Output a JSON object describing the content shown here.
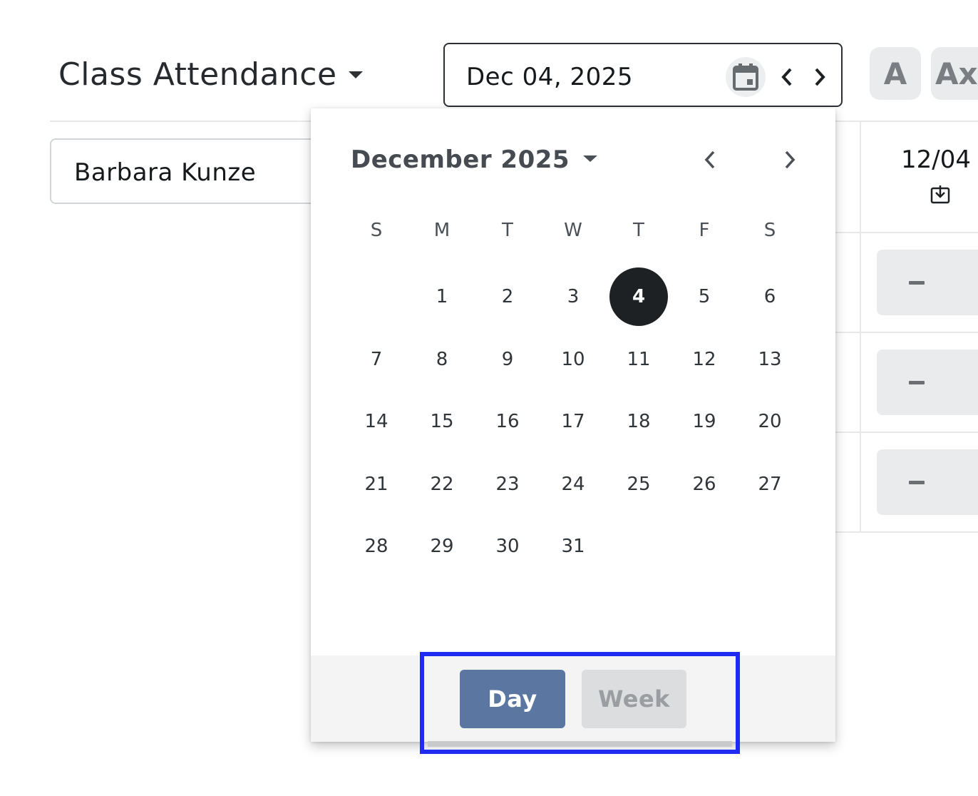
{
  "header": {
    "title": "Class Attendance",
    "date_value": "Dec 04, 2025",
    "icons": [
      "calendar-icon",
      "chevron-left-icon",
      "chevron-right-icon",
      "chevron-down-icon"
    ],
    "pill_a": "A",
    "pill_ax": "Ax"
  },
  "table": {
    "student_name": "Barbara Kunze",
    "column_date": "12/04",
    "rows": [
      {
        "status": "-"
      },
      {
        "status": "-"
      },
      {
        "status": "-"
      }
    ]
  },
  "calendar": {
    "month_label": "December 2025",
    "weekdays": [
      "S",
      "M",
      "T",
      "W",
      "T",
      "F",
      "S"
    ],
    "first_weekday_index": 1,
    "days_in_month": 31,
    "selected_day": 4,
    "footer": {
      "day_label": "Day",
      "week_label": "Week"
    }
  },
  "colors": {
    "selected_day_bg": "#1e2124",
    "day_button_bg": "#5b76a1",
    "week_button_bg": "#dcdddf",
    "highlight_border": "#1f2bf0"
  }
}
